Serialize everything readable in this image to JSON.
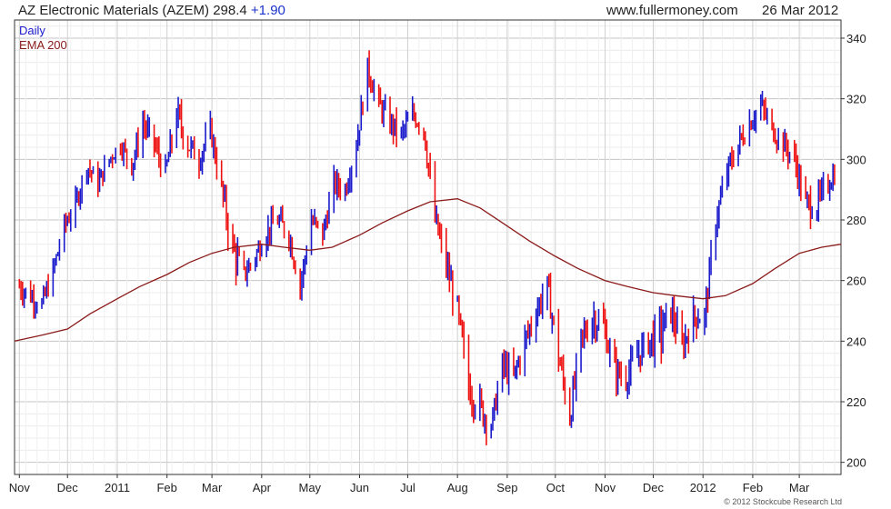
{
  "header": {
    "title": "AZ Electronic Materials (AZEM) 298.4",
    "change": "+1.90",
    "site": "www.fullermoney.com",
    "date": "26 Mar 2012"
  },
  "copyright": "© 2012 Stockcube Research Ltd",
  "colors": {
    "up": "#1a1acc",
    "down": "#ee1111",
    "ema": "#8b1a1a",
    "grid": "#d8d8d8"
  },
  "chart_data": {
    "type": "line",
    "legend": [
      {
        "name": "Daily",
        "color": "#1a1acc"
      },
      {
        "name": "EMA 200",
        "color": "#8b1a1a"
      }
    ],
    "legend_position": "top-left",
    "ylim": [
      196,
      346
    ],
    "y_ticks": [
      200,
      220,
      240,
      260,
      280,
      300,
      320,
      340
    ],
    "x_ticks": [
      "Nov",
      "Dec",
      "2011",
      "Feb",
      "Mar",
      "Apr",
      "May",
      "Jun",
      "Jul",
      "Aug",
      "Sep",
      "Oct",
      "Nov",
      "Dec",
      "2012",
      "Feb",
      "Mar"
    ],
    "x_tick_dates": [
      "2010-11-01",
      "2010-12-01",
      "2011-01-01",
      "2011-02-01",
      "2011-03-01",
      "2011-04-01",
      "2011-05-01",
      "2011-06-01",
      "2011-07-01",
      "2011-08-01",
      "2011-09-01",
      "2011-10-01",
      "2011-11-01",
      "2011-12-01",
      "2012-01-01",
      "2012-02-01",
      "2012-03-01"
    ],
    "x_range": [
      "2010-10-29",
      "2012-03-27"
    ],
    "grid": true,
    "series": [
      {
        "name": "Daily",
        "kind": "price",
        "x": [
          "2010-11-01",
          "2010-11-08",
          "2010-11-15",
          "2010-11-22",
          "2010-11-29",
          "2010-12-06",
          "2010-12-13",
          "2010-12-20",
          "2010-12-27",
          "2011-01-03",
          "2011-01-10",
          "2011-01-17",
          "2011-01-24",
          "2011-01-31",
          "2011-02-07",
          "2011-02-14",
          "2011-02-21",
          "2011-02-28",
          "2011-03-07",
          "2011-03-14",
          "2011-03-21",
          "2011-03-28",
          "2011-04-04",
          "2011-04-11",
          "2011-04-18",
          "2011-04-25",
          "2011-05-02",
          "2011-05-09",
          "2011-05-16",
          "2011-05-23",
          "2011-05-30",
          "2011-06-06",
          "2011-06-13",
          "2011-06-20",
          "2011-06-27",
          "2011-07-04",
          "2011-07-11",
          "2011-07-18",
          "2011-07-25",
          "2011-08-01",
          "2011-08-08",
          "2011-08-15",
          "2011-08-22",
          "2011-08-29",
          "2011-09-05",
          "2011-09-12",
          "2011-09-19",
          "2011-09-26",
          "2011-10-03",
          "2011-10-10",
          "2011-10-17",
          "2011-10-24",
          "2011-10-31",
          "2011-11-07",
          "2011-11-14",
          "2011-11-21",
          "2011-11-28",
          "2011-12-05",
          "2011-12-12",
          "2011-12-19",
          "2011-12-26",
          "2012-01-02",
          "2012-01-09",
          "2012-01-16",
          "2012-01-23",
          "2012-01-30",
          "2012-02-06",
          "2012-02-13",
          "2012-02-20",
          "2012-02-27",
          "2012-03-05",
          "2012-03-12",
          "2012-03-19",
          "2012-03-26"
        ],
        "y": [
          258,
          255,
          252,
          263,
          278,
          285,
          298,
          292,
          300,
          305,
          298,
          312,
          305,
          295,
          315,
          305,
          300,
          310,
          290,
          270,
          262,
          268,
          276,
          280,
          275,
          258,
          280,
          275,
          292,
          290,
          305,
          330,
          318,
          312,
          308,
          315,
          310,
          280,
          265,
          250,
          225,
          218,
          212,
          232,
          228,
          240,
          250,
          258,
          235,
          215,
          240,
          248,
          245,
          230,
          228,
          235,
          240,
          242,
          250,
          238,
          248,
          248,
          280,
          296,
          305,
          312,
          318,
          310,
          305,
          300,
          285,
          285,
          292,
          298
        ],
        "high": [
          268,
          263,
          260,
          270,
          285,
          293,
          306,
          300,
          308,
          312,
          306,
          322,
          314,
          305,
          328,
          316,
          310,
          318,
          300,
          282,
          272,
          276,
          284,
          290,
          284,
          268,
          290,
          285,
          300,
          298,
          315,
          338,
          326,
          322,
          318,
          322,
          318,
          292,
          278,
          262,
          238,
          232,
          226,
          242,
          238,
          250,
          262,
          270,
          248,
          230,
          252,
          262,
          256,
          242,
          240,
          246,
          252,
          268,
          262,
          250,
          258,
          260,
          290,
          305,
          315,
          320,
          325,
          319,
          314,
          310,
          296,
          296,
          302,
          304
        ],
        "low": [
          248,
          245,
          242,
          252,
          268,
          276,
          290,
          284,
          292,
          296,
          288,
          302,
          296,
          284,
          302,
          294,
          290,
          300,
          278,
          250,
          254,
          258,
          266,
          270,
          264,
          248,
          270,
          265,
          282,
          280,
          295,
          318,
          308,
          302,
          298,
          304,
          300,
          265,
          255,
          240,
          210,
          202,
          208,
          220,
          215,
          228,
          240,
          248,
          222,
          205,
          228,
          235,
          232,
          218,
          218,
          222,
          228,
          232,
          238,
          228,
          236,
          236,
          270,
          285,
          294,
          300,
          308,
          300,
          295,
          290,
          272,
          272,
          282,
          290
        ]
      },
      {
        "name": "EMA 200",
        "kind": "line",
        "x": [
          "2010-10-29",
          "2010-11-15",
          "2010-12-01",
          "2010-12-15",
          "2011-01-01",
          "2011-01-15",
          "2011-02-01",
          "2011-02-15",
          "2011-03-01",
          "2011-03-15",
          "2011-04-01",
          "2011-04-15",
          "2011-05-01",
          "2011-05-15",
          "2011-06-01",
          "2011-06-15",
          "2011-07-01",
          "2011-07-15",
          "2011-08-01",
          "2011-08-15",
          "2011-09-01",
          "2011-09-15",
          "2011-10-01",
          "2011-10-15",
          "2011-11-01",
          "2011-11-15",
          "2011-12-01",
          "2011-12-15",
          "2012-01-01",
          "2012-01-15",
          "2012-02-01",
          "2012-02-15",
          "2012-03-01",
          "2012-03-15",
          "2012-03-27"
        ],
        "y": [
          240,
          242,
          244,
          249,
          254,
          258,
          262,
          266,
          269,
          271,
          272,
          271,
          270,
          271,
          275,
          279,
          283,
          286,
          287,
          284,
          278,
          273,
          268,
          264,
          260,
          258,
          256,
          255,
          254,
          255,
          259,
          264,
          269,
          271,
          272
        ]
      }
    ]
  }
}
